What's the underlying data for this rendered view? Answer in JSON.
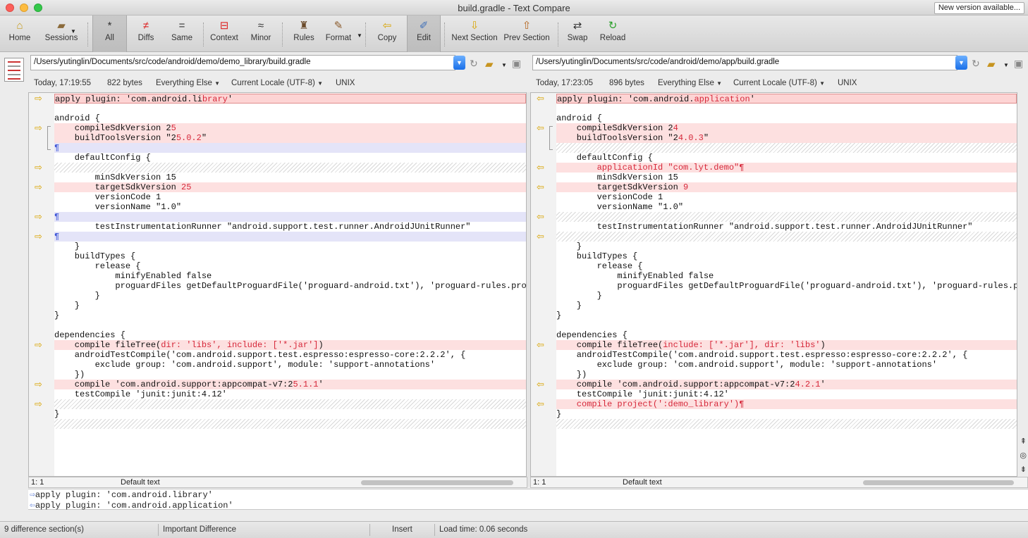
{
  "window": {
    "title": "build.gradle - Text Compare",
    "new_version_button": "New version available..."
  },
  "toolbar": {
    "home": "Home",
    "sessions": "Sessions",
    "all": "All",
    "diffs": "Diffs",
    "same": "Same",
    "context": "Context",
    "minor": "Minor",
    "rules": "Rules",
    "format": "Format",
    "copy": "Copy",
    "edit": "Edit",
    "next_section": "Next Section",
    "prev_section": "Prev Section",
    "swap": "Swap",
    "reload": "Reload"
  },
  "left": {
    "path": "/Users/yutinglin/Documents/src/code/android/demo/demo_library/build.gradle",
    "timestamp": "Today, 17:19:55",
    "size": "822 bytes",
    "filter": "Everything Else",
    "encoding": "Current Locale (UTF-8)",
    "line_endings": "UNIX",
    "status_pos": "1: 1",
    "status_style": "Default text"
  },
  "right": {
    "path": "/Users/yutinglin/Documents/src/code/android/demo/app/build.gradle",
    "timestamp": "Today, 17:23:05",
    "size": "896 bytes",
    "filter": "Everything Else",
    "encoding": "Current Locale (UTF-8)",
    "line_endings": "UNIX",
    "status_pos": "1: 1",
    "status_style": "Default text"
  },
  "compare": {
    "left_line": "apply plugin: 'com.android.library'",
    "right_line": "apply plugin: 'com.android.application'"
  },
  "statusbar": {
    "sections": "9 difference section(s)",
    "importance": "Important Difference",
    "mode": "Insert",
    "load_time": "Load time: 0.06 seconds"
  },
  "left_lines": [
    {
      "s": "first",
      "a": 1,
      "t": "apply plugin: 'com.android.li",
      "r": "brary",
      "e": "'"
    },
    {
      "s": "blank",
      "t": ""
    },
    {
      "s": "blank",
      "t": "android {"
    },
    {
      "s": "changed",
      "a": 1,
      "t": "    compileSdkVersion 2",
      "r": "5",
      "e": ""
    },
    {
      "s": "changed",
      "t": "    buildToolsVersion \"2",
      "r": "5.0.2",
      "e": "\""
    },
    {
      "s": "para",
      "t": "",
      "pil": 1
    },
    {
      "s": "blank",
      "t": "    defaultConfig {"
    },
    {
      "s": "hatch",
      "a": 1,
      "t": ""
    },
    {
      "s": "blank",
      "t": "        minSdkVersion 15"
    },
    {
      "s": "changed",
      "a": 1,
      "t": "        targetSdkVersion ",
      "r": "25",
      "e": ""
    },
    {
      "s": "blank",
      "t": "        versionCode 1"
    },
    {
      "s": "blank",
      "t": "        versionName \"1.0\""
    },
    {
      "s": "para",
      "a": 1,
      "t": "",
      "pil": 1
    },
    {
      "s": "blank",
      "t": "        testInstrumentationRunner \"android.support.test.runner.AndroidJUnitRunner\""
    },
    {
      "s": "para",
      "a": 1,
      "t": "",
      "pil": 1
    },
    {
      "s": "blank",
      "t": "    }"
    },
    {
      "s": "blank",
      "t": "    buildTypes {"
    },
    {
      "s": "blank",
      "t": "        release {"
    },
    {
      "s": "blank",
      "t": "            minifyEnabled false"
    },
    {
      "s": "blank",
      "t": "            proguardFiles getDefaultProguardFile('proguard-android.txt'), 'proguard-rules.pro'"
    },
    {
      "s": "blank",
      "t": "        }"
    },
    {
      "s": "blank",
      "t": "    }"
    },
    {
      "s": "blank",
      "t": "}"
    },
    {
      "s": "blank",
      "t": ""
    },
    {
      "s": "blank",
      "t": "dependencies {"
    },
    {
      "s": "changed",
      "a": 1,
      "t": "    compile fileTree(",
      "r": "dir: 'libs', include: ['*.jar']",
      "e": ")"
    },
    {
      "s": "blank",
      "t": "    androidTestCompile('com.android.support.test.espresso:espresso-core:2.2.2', {"
    },
    {
      "s": "blank",
      "t": "        exclude group: 'com.android.support', module: 'support-annotations'"
    },
    {
      "s": "blank",
      "t": "    })"
    },
    {
      "s": "changed",
      "a": 1,
      "t": "    compile 'com.android.support:appcompat-v7:2",
      "r": "5.1.1",
      "e": "'"
    },
    {
      "s": "blank",
      "t": "    testCompile 'junit:junit:4.12'"
    },
    {
      "s": "hatch",
      "a": 1,
      "t": ""
    },
    {
      "s": "blank",
      "t": "}"
    },
    {
      "s": "hatch",
      "t": ""
    }
  ],
  "right_lines": [
    {
      "s": "first",
      "a": 1,
      "t": "apply plugin: 'com.android.",
      "r": "application",
      "e": "'"
    },
    {
      "s": "blank",
      "t": ""
    },
    {
      "s": "blank",
      "t": "android {"
    },
    {
      "s": "changed",
      "a": 1,
      "t": "    compileSdkVersion 2",
      "r": "4",
      "e": ""
    },
    {
      "s": "changed",
      "t": "    buildToolsVersion \"2",
      "r": "4.0.3",
      "e": "\""
    },
    {
      "s": "hatch",
      "t": ""
    },
    {
      "s": "blank",
      "t": "    defaultConfig {"
    },
    {
      "s": "changed",
      "a": 1,
      "t": "",
      "r": "        applicationId \"com.lyt.demo\"",
      "e": "",
      "pil": 1
    },
    {
      "s": "blank",
      "t": "        minSdkVersion 15"
    },
    {
      "s": "changed",
      "a": 1,
      "t": "        targetSdkVersion ",
      "r": "9",
      "e": ""
    },
    {
      "s": "blank",
      "t": "        versionCode 1"
    },
    {
      "s": "blank",
      "t": "        versionName \"1.0\""
    },
    {
      "s": "hatch",
      "a": 1,
      "t": ""
    },
    {
      "s": "blank",
      "t": "        testInstrumentationRunner \"android.support.test.runner.AndroidJUnitRunner\""
    },
    {
      "s": "hatch",
      "a": 1,
      "t": ""
    },
    {
      "s": "blank",
      "t": "    }"
    },
    {
      "s": "blank",
      "t": "    buildTypes {"
    },
    {
      "s": "blank",
      "t": "        release {"
    },
    {
      "s": "blank",
      "t": "            minifyEnabled false"
    },
    {
      "s": "blank",
      "t": "            proguardFiles getDefaultProguardFile('proguard-android.txt'), 'proguard-rules.pro'"
    },
    {
      "s": "blank",
      "t": "        }"
    },
    {
      "s": "blank",
      "t": "    }"
    },
    {
      "s": "blank",
      "t": "}"
    },
    {
      "s": "blank",
      "t": ""
    },
    {
      "s": "blank",
      "t": "dependencies {"
    },
    {
      "s": "changed",
      "a": 1,
      "t": "    compile fileTree(",
      "r": "include: ['*.jar'], dir: 'libs'",
      "e": ")"
    },
    {
      "s": "blank",
      "t": "    androidTestCompile('com.android.support.test.espresso:espresso-core:2.2.2', {"
    },
    {
      "s": "blank",
      "t": "        exclude group: 'com.android.support', module: 'support-annotations'"
    },
    {
      "s": "blank",
      "t": "    })"
    },
    {
      "s": "changed",
      "a": 1,
      "t": "    compile 'com.android.support:appcompat-v7:2",
      "r": "4.2.1",
      "e": "'"
    },
    {
      "s": "blank",
      "t": "    testCompile 'junit:junit:4.12'"
    },
    {
      "s": "changed",
      "a": 1,
      "t": "",
      "r": "    compile project(':demo_library')",
      "e": "",
      "pil": 1
    },
    {
      "s": "blank",
      "t": "}"
    },
    {
      "s": "hatch",
      "t": ""
    }
  ]
}
